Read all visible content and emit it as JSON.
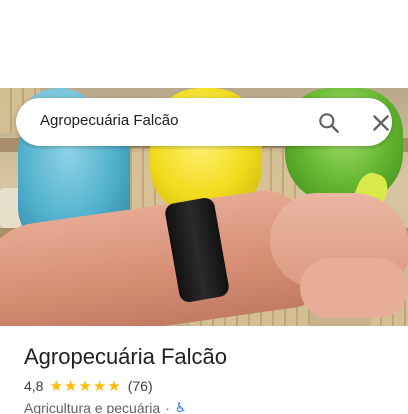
{
  "search": {
    "query": "Agropecuária Falcão"
  },
  "icons": {
    "search": "search-icon",
    "close": "close-icon",
    "star": "star-icon",
    "accessibility": "wheelchair-accessible-icon"
  },
  "colors": {
    "star": "#fbbc04",
    "accessibility": "#1a73e8",
    "title": "#202124"
  },
  "place": {
    "name": "Agropecuária Falcão",
    "rating": "4,8",
    "rating_stars": 5,
    "review_count": "(76)",
    "category": "Agricultura e pecuária",
    "separator": "·"
  }
}
